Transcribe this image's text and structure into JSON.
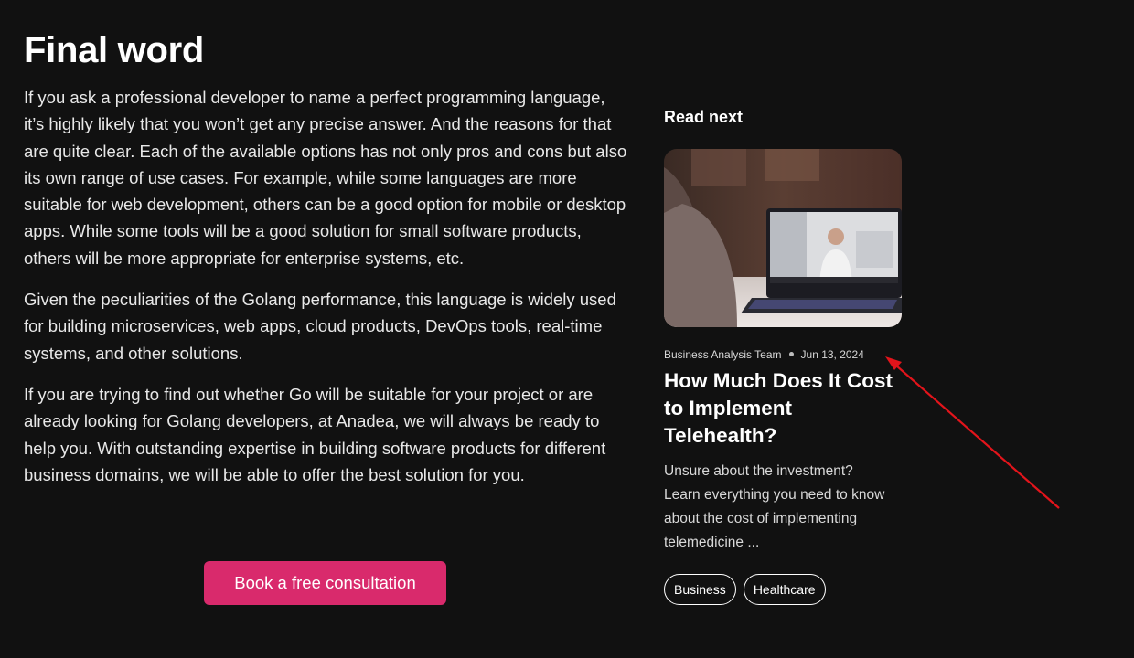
{
  "section": {
    "title": "Final word",
    "paragraphs": [
      "If you ask a professional developer to name a perfect programming language, it’s highly likely that you won’t get any precise answer. And the reasons for that are quite clear. Each of the available options has not only pros and cons but also its own range of use cases. For example, while some languages are more suitable for web development, others can be a good option for mobile or desktop apps. While some tools will be a good solution for small software products, others will be more appropriate for enterprise systems, etc.",
      "Given the peculiarities of the Golang performance, this language is widely used for building microservices, web apps, cloud products, DevOps tools, real-time systems, and other solutions.",
      "If you are trying to find out whether Go will be suitable for your project or are already looking for Golang developers, at Anadea, we will always be ready to help you. With outstanding expertise in building software products for different business domains, we will be able to offer the best solution for you."
    ],
    "cta_label": "Book a free consultation"
  },
  "sidebar": {
    "heading": "Read next",
    "post": {
      "author": "Business Analysis Team",
      "date": "Jun 13, 2024",
      "title": "How Much Does It Cost to Implement Telehealth?",
      "excerpt": "Unsure about the investment? Learn everything you need to know about the cost of implementing telemedicine ...",
      "tags": [
        "Business",
        "Healthcare"
      ]
    }
  },
  "colors": {
    "background": "#111111",
    "accent": "#d92a6c",
    "annotation_arrow": "#e3141b"
  }
}
